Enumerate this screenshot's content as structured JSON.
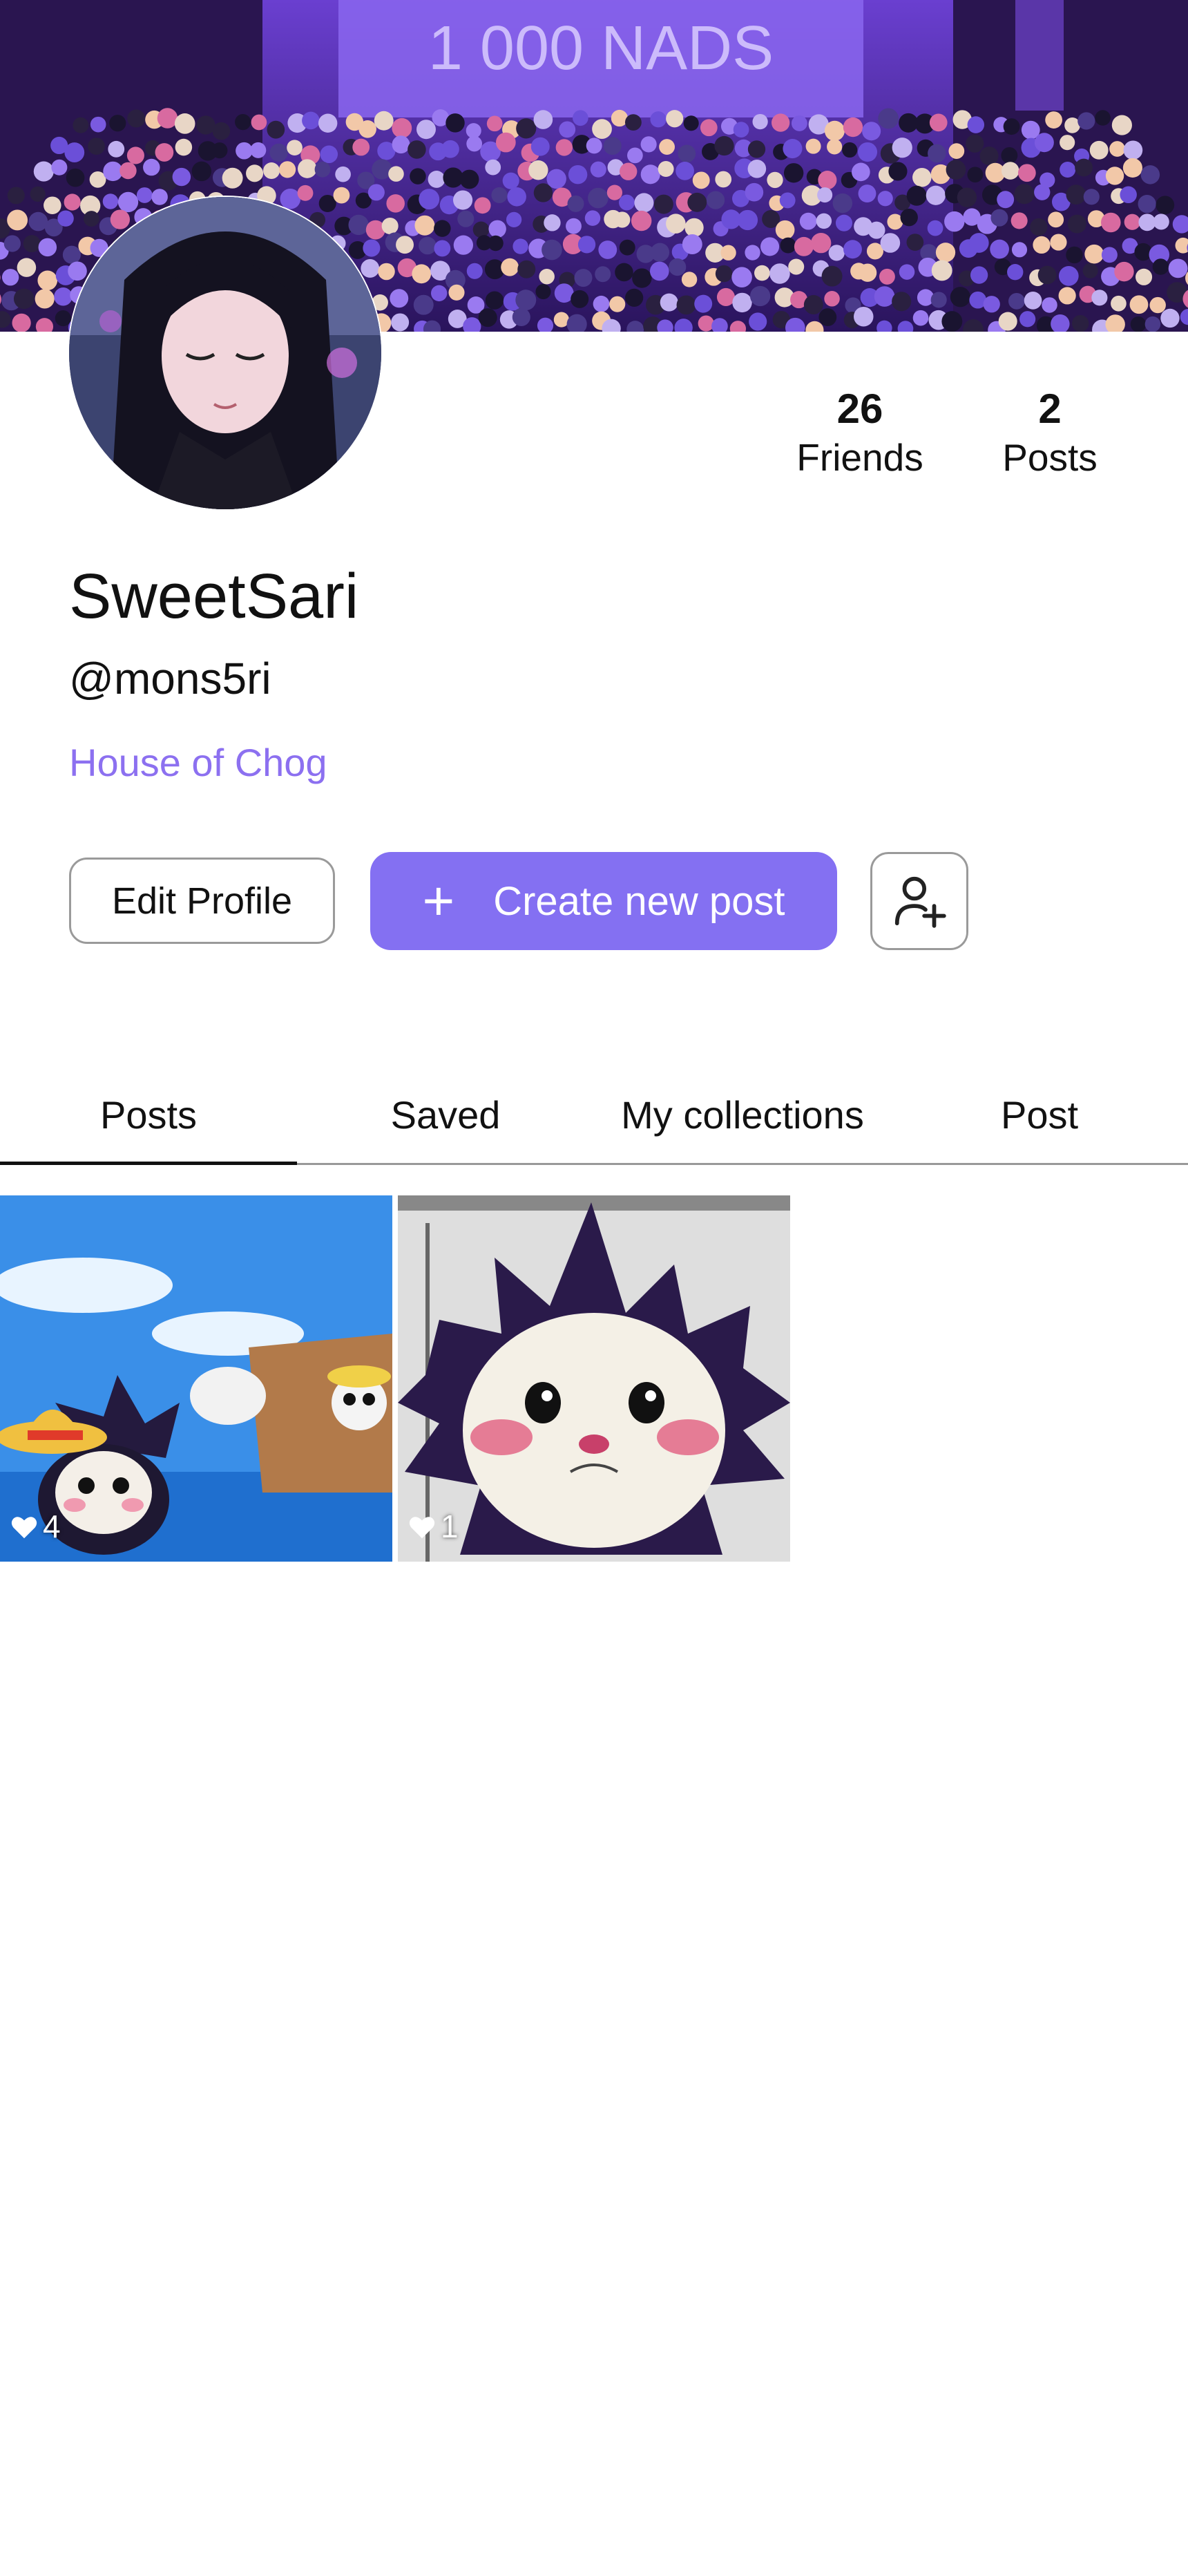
{
  "banner": {
    "sign_text": "1 000 NADS"
  },
  "profile": {
    "display_name": "SweetSari",
    "handle": "@mons5ri",
    "guild": "House of Chog"
  },
  "stats": [
    {
      "value": "26",
      "label": "Friends"
    },
    {
      "value": "2",
      "label": "Posts"
    }
  ],
  "actions": {
    "edit_label": "Edit Profile",
    "create_label": "Create new post",
    "plus_glyph": "+",
    "add_friend_icon": "user-plus-icon"
  },
  "tabs": [
    {
      "label": "Posts",
      "active": true
    },
    {
      "label": "Saved",
      "active": false
    },
    {
      "label": "My collections",
      "active": false
    },
    {
      "label": "Post",
      "active": false
    }
  ],
  "posts": [
    {
      "likes": "4"
    },
    {
      "likes": "1"
    }
  ],
  "colors": {
    "accent": "#8470f2",
    "guild_text": "#8c70f0",
    "banner": "#3a1f7a"
  }
}
